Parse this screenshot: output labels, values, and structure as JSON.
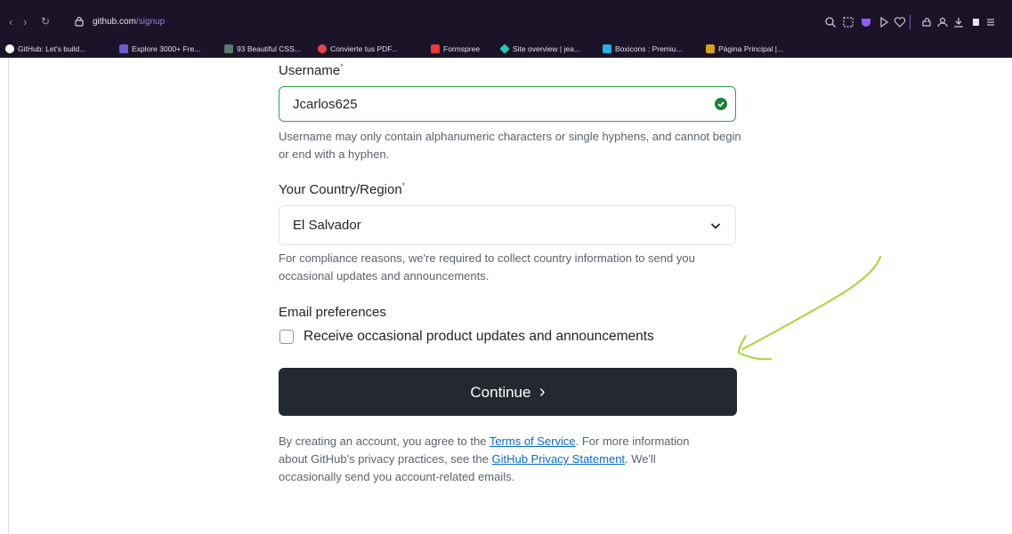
{
  "browser": {
    "url_host": "github.com",
    "url_path": "/signup",
    "bookmarks": [
      {
        "label": "GitHub: Let's build...",
        "color": "#ffffff"
      },
      {
        "label": "Explore 3000+ Fre...",
        "color": "#6d5bd0"
      },
      {
        "label": "93 Beautiful CSS...",
        "color": "#5a7a6a"
      },
      {
        "label": "Convierte tus PDF...",
        "color": "#e04848"
      },
      {
        "label": "Formspree",
        "color": "#e83a3a"
      },
      {
        "label": "Site overview | jea...",
        "color": "#2ec4b6"
      },
      {
        "label": "Boxicons : Premiu...",
        "color": "#2ab0e0"
      },
      {
        "label": "Página Principal |...",
        "color": "#d4a020"
      }
    ]
  },
  "form": {
    "username": {
      "label": "Username",
      "required_mark": "*",
      "value": "Jcarlos625",
      "help": "Username may only contain alphanumeric characters or single hyphens, and cannot begin or end with a hyphen."
    },
    "country": {
      "label": "Your Country/Region",
      "required_mark": "*",
      "value": "El Salvador",
      "help": "For compliance reasons, we're required to collect country information to send you occasional updates and announcements."
    },
    "email_prefs": {
      "label": "Email preferences",
      "checkbox_label": "Receive occasional product updates and announcements",
      "checked": false
    },
    "continue_label": "Continue",
    "continue_chevron": "›",
    "legal": {
      "prefix": "By creating an account, you agree to the ",
      "terms_link": "Terms of Service",
      "middle": ". For more information about GitHub's privacy practices, see the ",
      "privacy_link": "GitHub Privacy Statement",
      "suffix": ". We'll occasionally send you account-related emails."
    }
  },
  "colors": {
    "valid_border": "#2da44e",
    "button_bg": "#24292f",
    "link": "#0969da",
    "annotation_arrow": "#a4d63a"
  }
}
